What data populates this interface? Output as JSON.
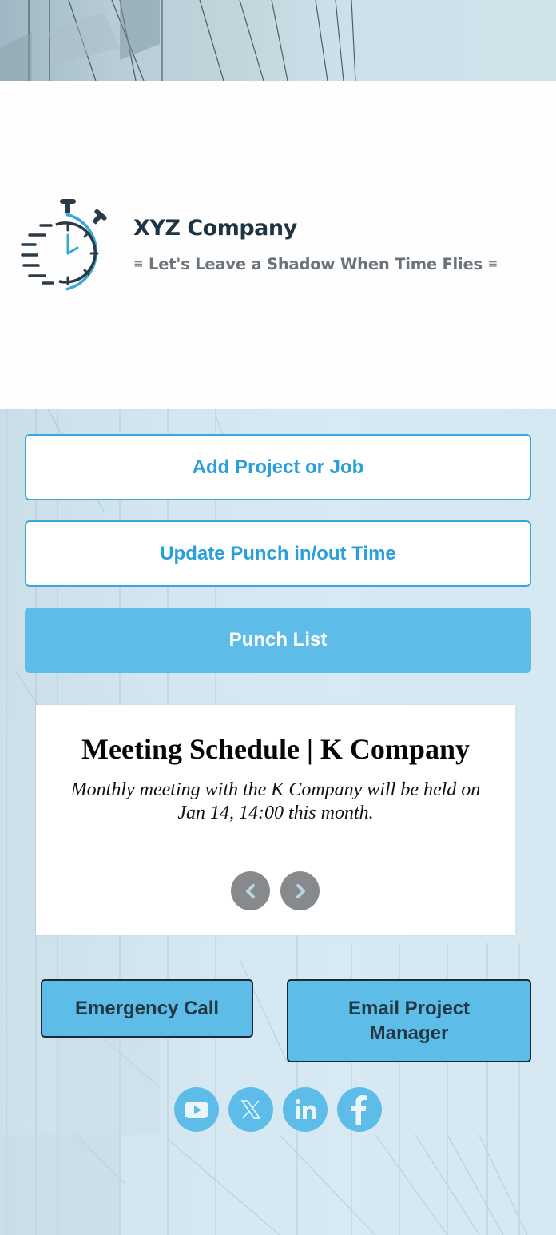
{
  "brand": {
    "company_name": "XYZ Company",
    "tagline": "Let's Leave a Shadow When Time Flies",
    "tagline_decoration": "≡",
    "logo_icon": "stopwatch-icon",
    "colors": {
      "accent": "#2a9fd9",
      "button_fill": "#5dbde8",
      "dark_text": "#1f3443",
      "tagline_gray": "#6a737a"
    }
  },
  "actions": {
    "add_project": "Add Project or Job",
    "update_punch": "Update Punch in/out Time",
    "punch_list": "Punch List"
  },
  "slider": {
    "title": "Meeting Schedule | K Company",
    "body": "Monthly meeting with the K Company will be held on Jan 14, 14:00 this month.",
    "prev_icon": "chevron-left-icon",
    "next_icon": "chevron-right-icon"
  },
  "contact": {
    "emergency_call": "Emergency Call",
    "email_pm": "Email Project Manager"
  },
  "social": [
    {
      "name": "YouTube",
      "icon": "youtube-icon"
    },
    {
      "name": "X",
      "icon": "x-twitter-icon"
    },
    {
      "name": "LinkedIn",
      "icon": "linkedin-icon"
    },
    {
      "name": "Facebook",
      "icon": "facebook-icon"
    }
  ]
}
